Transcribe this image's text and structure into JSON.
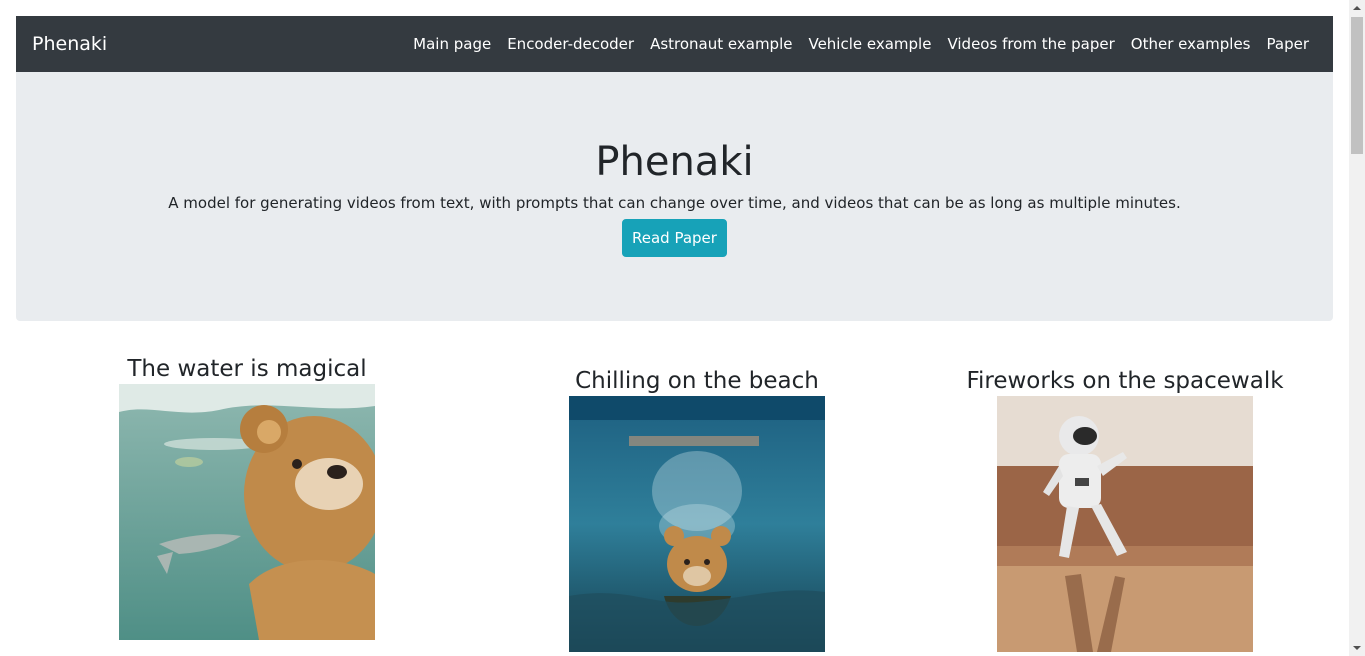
{
  "navbar": {
    "brand": "Phenaki",
    "links": [
      "Main page",
      "Encoder-decoder",
      "Astronaut example",
      "Vehicle example",
      "Videos from the paper",
      "Other examples",
      "Paper"
    ]
  },
  "hero": {
    "title": "Phenaki",
    "lead": "A model for generating videos from text, with prompts that can change over time, and videos that can be as long as multiple minutes.",
    "button": "Read Paper"
  },
  "examples": [
    {
      "caption": "The water is magical"
    },
    {
      "caption": "Chilling on the beach"
    },
    {
      "caption": "Fireworks on the spacewalk"
    }
  ],
  "colors": {
    "navbar": "#343a40",
    "jumbotron": "#e9ecef",
    "button": "#17a2b8"
  }
}
